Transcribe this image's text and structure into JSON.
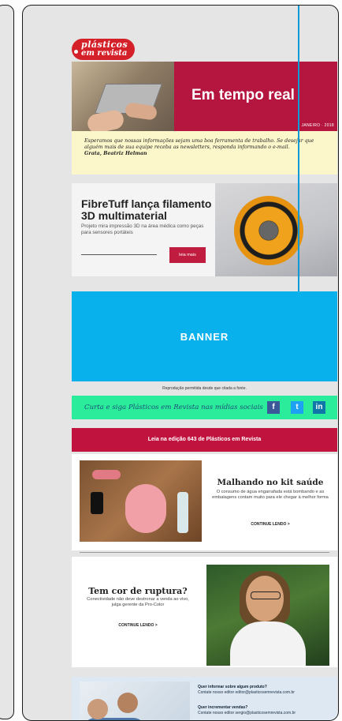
{
  "logo": {
    "line1": "plásticos",
    "line2": "em revista"
  },
  "hero": {
    "title": "Em tempo real",
    "date": "JANEIRO · 2018",
    "note": "Esperamos que nossas informações sejam uma boa ferramenta de trabalho. Se desejar que alguém mais de sua equipe receba as newsletters, responda informando o e-mail.",
    "signature": "Grata, Beatriz Helman"
  },
  "article": {
    "title": "FibreTuff lança filamento 3D multimaterial",
    "subtitle": "Projeto mira impressão 3D na área médica como peças para sensores portáteis",
    "button": "leia mais"
  },
  "banner": {
    "label": "BANNER"
  },
  "reproduction": "Reprodução permitida desde que citada a fonte.",
  "social": {
    "text": "Curta e siga Plásticos em Revista nas mídias sociais",
    "fb": "f",
    "tw": "t",
    "in": "in"
  },
  "edition": {
    "label": "Leia na edição 643 de Plásticos em Revista"
  },
  "story1": {
    "title": "Malhando no kit saúde",
    "text": "O consumo de água engarrafada está bombando e as embalagens contam muito para ele chegar à melhor forma",
    "link": "CONTINUE LENDO >"
  },
  "story2": {
    "title": "Tem cor de ruptura?",
    "text": "Conectividade não deve destronar a venda ao vivo, julga gerente da Pro-Color",
    "link": "CONTINUE LENDO >"
  },
  "promo": {
    "q1": "Quer informar sobre algum produto?",
    "a1": "Contate nosso editor editor@plasticosemrevista.com.br",
    "q2": "Quer incrementar vendas?",
    "a2": "Contate nosso editor sergio@plasticosemrevista.com.br"
  },
  "colors": {
    "brand_red": "#c0143f",
    "banner_blue": "#09b1ec",
    "social_green": "#2aec9a"
  }
}
